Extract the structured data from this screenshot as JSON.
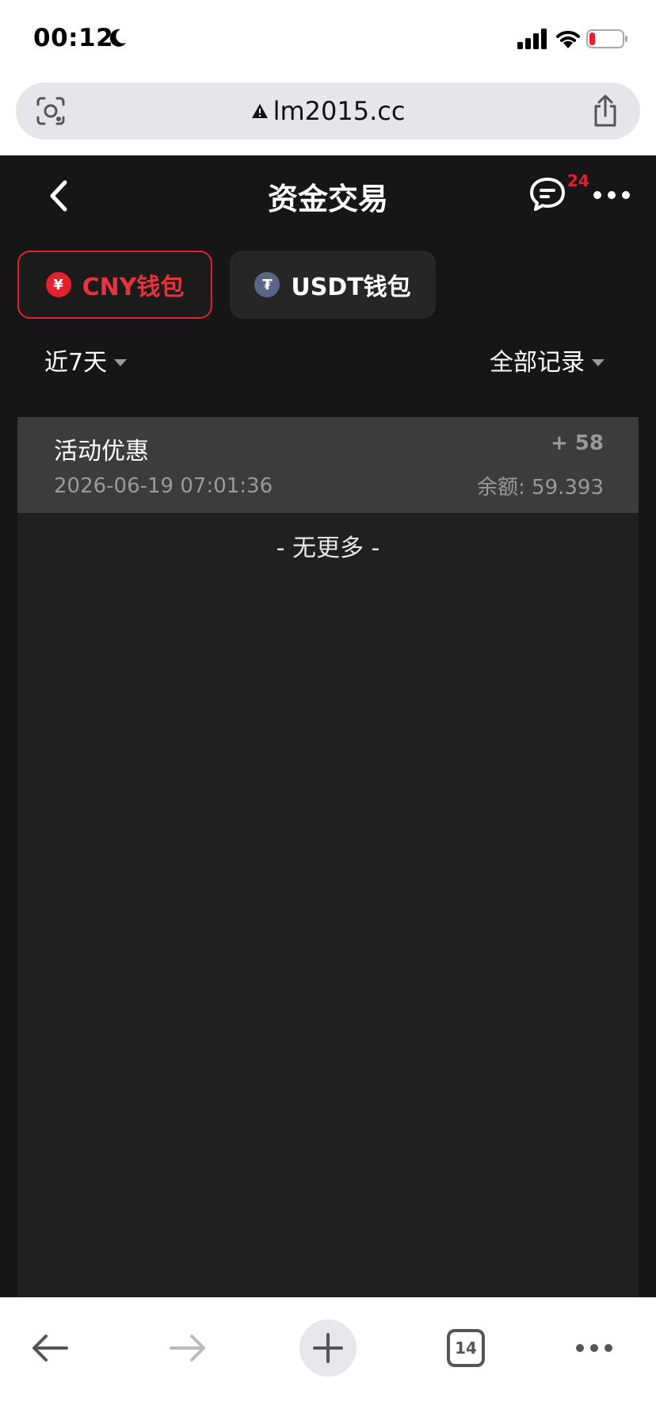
{
  "status": {
    "time": "00:12"
  },
  "browser": {
    "url": "lm2015.cc",
    "tab_count": "14"
  },
  "header": {
    "title": "资金交易",
    "message_badge": "24"
  },
  "tabs": [
    {
      "label": "CNY钱包",
      "icon": "¥",
      "active": true
    },
    {
      "label": "USDT钱包",
      "icon": "₮",
      "active": false
    }
  ],
  "filters": {
    "period": "近7天",
    "type": "全部记录"
  },
  "records": [
    {
      "title": "活动优惠",
      "time": "2026-06-19 07:01:36",
      "amount": "+ 58",
      "balance": "余额: 59.393"
    }
  ],
  "footer_text": "- 无更多 -",
  "colors": {
    "accent": "#e3202d",
    "background": "#161616",
    "panel": "#202020"
  }
}
